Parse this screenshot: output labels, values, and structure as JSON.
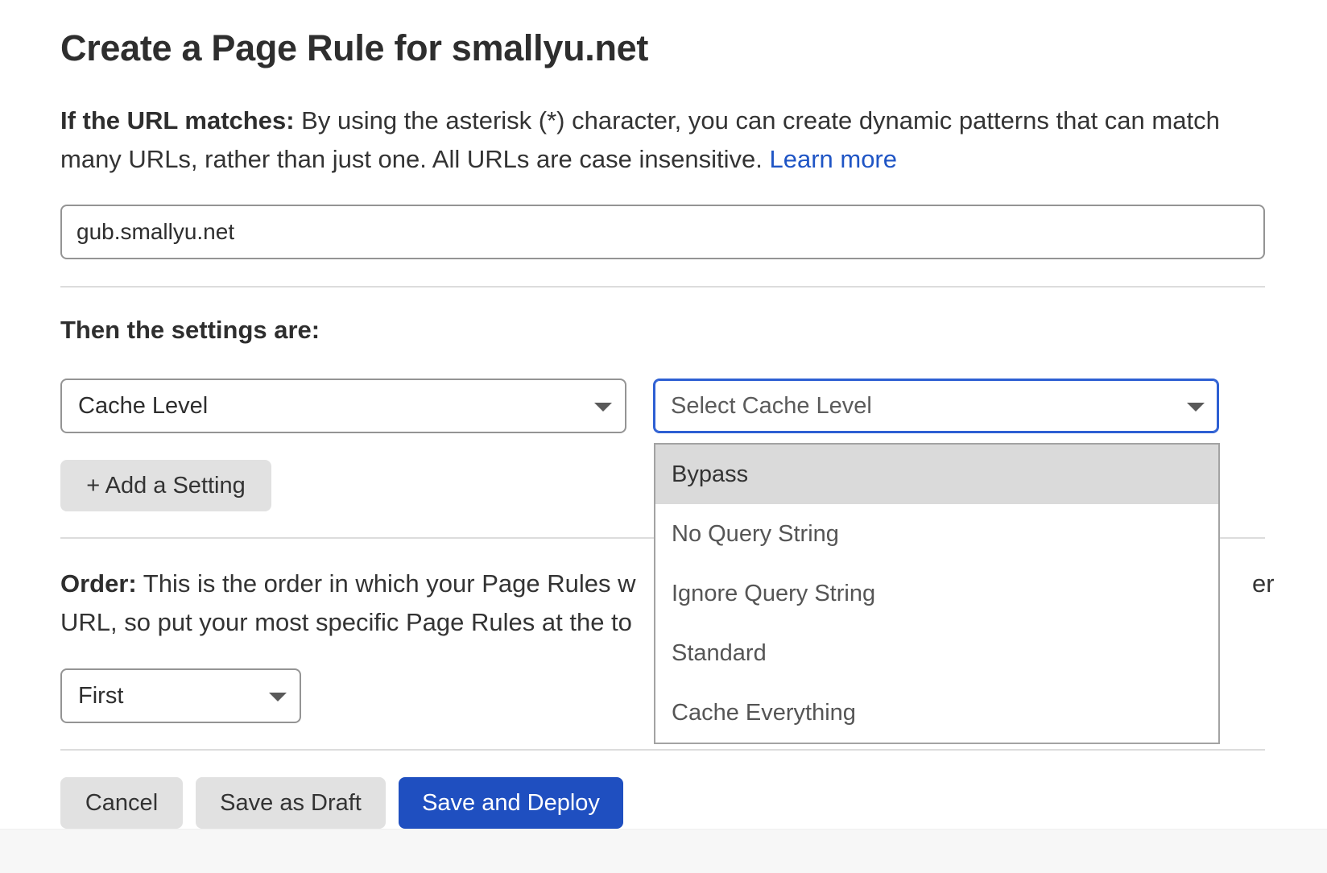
{
  "page": {
    "title": "Create a Page Rule for smallyu.net"
  },
  "url_section": {
    "label": "If the URL matches:",
    "description": " By using the asterisk (*) character, you can create dynamic patterns that can match many URLs, rather than just one. All URLs are case insensitive. ",
    "learn_more": "Learn more",
    "url_value": "gub.smallyu.net"
  },
  "settings_section": {
    "label": "Then the settings are:",
    "setting_select": {
      "value": "Cache Level"
    },
    "cache_level_select": {
      "placeholder": "Select Cache Level",
      "options": [
        {
          "label": "Bypass",
          "highlighted": true
        },
        {
          "label": "No Query String",
          "highlighted": false
        },
        {
          "label": "Ignore Query String",
          "highlighted": false
        },
        {
          "label": "Standard",
          "highlighted": false
        },
        {
          "label": "Cache Everything",
          "highlighted": false
        }
      ]
    },
    "add_setting_label": "+ Add a Setting"
  },
  "order_section": {
    "label": "Order:",
    "description": " This is the order in which your Page Rules w",
    "description_end": "er",
    "description_line2": "URL, so put your most specific Page Rules at the to",
    "order_select": {
      "value": "First"
    }
  },
  "actions": {
    "cancel_label": "Cancel",
    "draft_label": "Save as Draft",
    "deploy_label": "Save and Deploy"
  },
  "colors": {
    "primary": "#1f4fc0",
    "link": "#1f55c5",
    "focus_border": "#2d5fd3",
    "secondary_button": "#e1e1e1",
    "highlight_row": "#dadada"
  },
  "icons": [
    "chevron-down-icon"
  ]
}
